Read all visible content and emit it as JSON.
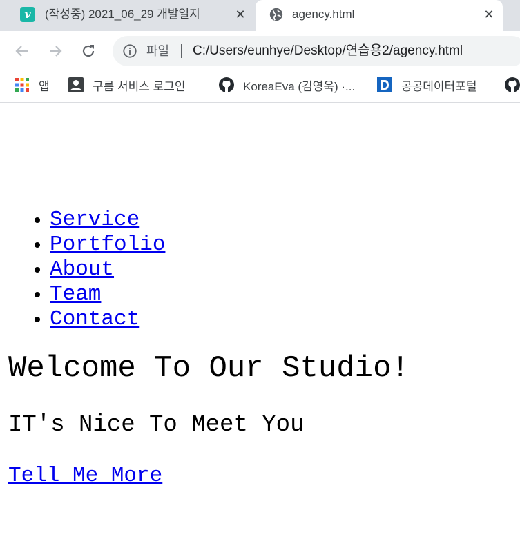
{
  "browser": {
    "tabs": [
      {
        "title": "(작성중) 2021_06_29 개발일지",
        "favicon": "velog-v-icon",
        "active": false
      },
      {
        "title": "agency.html",
        "favicon": "globe-icon",
        "active": true
      }
    ],
    "favicon_letter": "v",
    "close_glyph": "✕",
    "omnibox": {
      "chip_label": "파일",
      "url": "C:/Users/eunhye/Desktop/연습용2/agency.html"
    },
    "bookmarks": [
      {
        "label": "앱",
        "icon": "apps-grid-icon"
      },
      {
        "label": "구름 서비스 로그인",
        "icon": "person-icon"
      },
      {
        "label": "KoreaEva (김영욱) ·...",
        "icon": "github-icon"
      },
      {
        "label": "공공데이터포털",
        "icon": "data-portal-d-icon"
      }
    ]
  },
  "page": {
    "nav": [
      {
        "label": "Service"
      },
      {
        "label": "Portfolio"
      },
      {
        "label": "About"
      },
      {
        "label": "Team"
      },
      {
        "label": "Contact"
      }
    ],
    "hero_title": "Welcome To Our Studio!",
    "hero_subtitle": "IT's Nice To Meet You",
    "hero_link": "Tell Me More"
  },
  "colors": {
    "tabstrip": "#dee1e6",
    "link": "#0000ee",
    "velog": "#1ab7a7"
  }
}
